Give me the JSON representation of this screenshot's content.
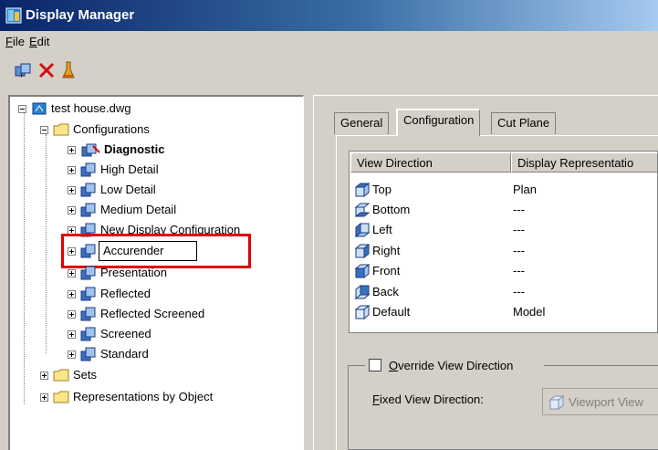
{
  "window": {
    "title": "Display Manager"
  },
  "menu": {
    "file": "File",
    "file_mnemonic": "F",
    "file_rest": "ile",
    "edit": "Edit",
    "edit_mnemonic": "E",
    "edit_rest": "dit"
  },
  "toolbar": {
    "buttons": [
      "new-display-config-icon",
      "delete-icon",
      "purge-icon"
    ]
  },
  "tree": {
    "root": "test house.dwg",
    "configurations": "Configurations",
    "items": [
      {
        "label": "Diagnostic",
        "bold": true
      },
      {
        "label": "High Detail"
      },
      {
        "label": "Low Detail"
      },
      {
        "label": "Medium Detail"
      },
      {
        "label": "New Display Configuration"
      },
      {
        "label": "Accurender",
        "editing": true
      },
      {
        "label": "Presentation"
      },
      {
        "label": "Reflected"
      },
      {
        "label": "Reflected Screened"
      },
      {
        "label": "Screened"
      },
      {
        "label": "Standard"
      }
    ],
    "sets": "Sets",
    "representations": "Representations by Object"
  },
  "tabs": [
    {
      "label": "General",
      "active": false
    },
    {
      "label": "Configuration",
      "active": true
    },
    {
      "label": "Cut Plane",
      "active": false
    }
  ],
  "list": {
    "columns": [
      "View Direction",
      "Display Representatio"
    ],
    "rows": [
      {
        "dir": "Top",
        "rep": "Plan"
      },
      {
        "dir": "Bottom",
        "rep": "---"
      },
      {
        "dir": "Left",
        "rep": "---"
      },
      {
        "dir": "Right",
        "rep": "---"
      },
      {
        "dir": "Front",
        "rep": "---"
      },
      {
        "dir": "Back",
        "rep": "---"
      },
      {
        "dir": "Default",
        "rep": "Model"
      }
    ]
  },
  "override": {
    "label": "Override View Direction",
    "checked": false,
    "fixed_label": "Fixed View Direction:",
    "fixed_value": "Viewport View"
  },
  "colors": {
    "title_bar": "#0a246a",
    "highlight": "#e00000",
    "face": "#d4d0c8"
  }
}
